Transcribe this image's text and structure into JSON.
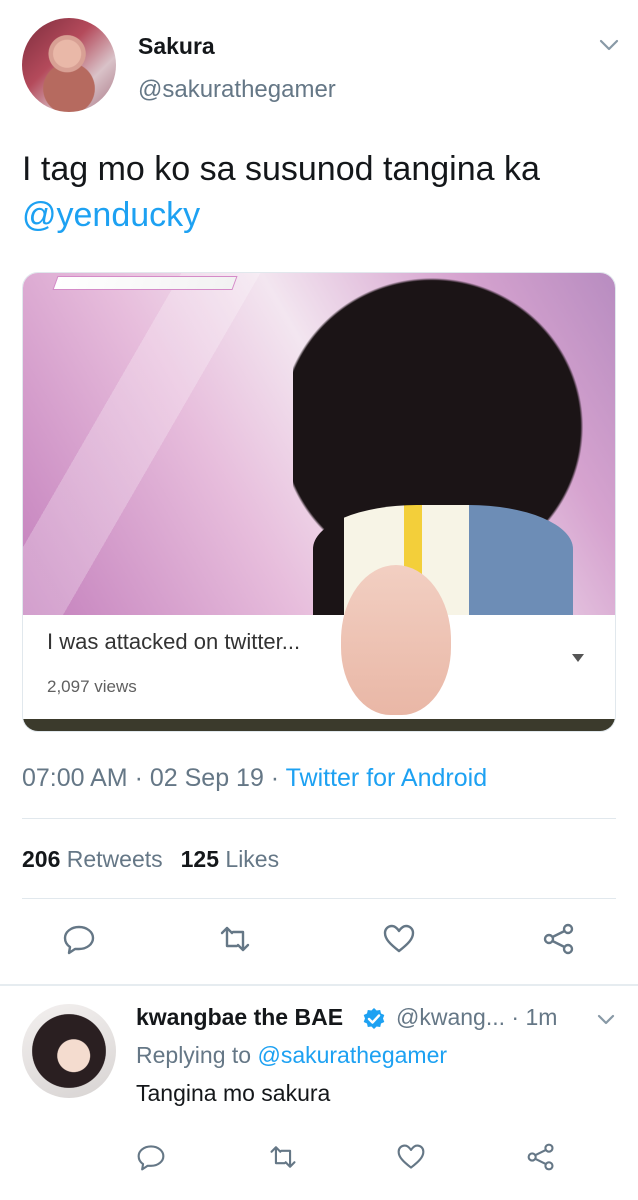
{
  "tweet": {
    "author_name": "Sakura",
    "author_handle": "@sakurathegamer",
    "text": "I tag mo ko sa susunod tangina ka",
    "mention": "@yenducky",
    "media": {
      "banner_text": "",
      "title": "I was attacked on twitter...",
      "views": "2,097 views"
    },
    "time": "07:00 AM",
    "separator1": " · ",
    "date": "02 Sep 19",
    "separator2": " · ",
    "source": "Twitter for Android",
    "retweets_count": "206",
    "retweets_label": "Retweets",
    "likes_count": "125",
    "likes_label": "Likes",
    "icons": [
      "reply-icon",
      "retweet-icon",
      "like-icon",
      "share-icon",
      "chevron-down-icon"
    ]
  },
  "reply": {
    "author_name": "kwangbae the BAE",
    "author_handle": "@kwang...",
    "dot": " · ",
    "time": "1m",
    "replying_prefix": "Replying to ",
    "replying_to": "@sakurathegamer",
    "text": "Tangina mo sakura",
    "icons": [
      "reply-icon",
      "retweet-icon",
      "like-icon",
      "share-icon",
      "verified-badge-icon",
      "chevron-down-icon"
    ]
  },
  "colors": {
    "link": "#1da1f2",
    "secondary_text": "#657786",
    "primary_text": "#14171a",
    "divider": "#e1e8ed"
  }
}
